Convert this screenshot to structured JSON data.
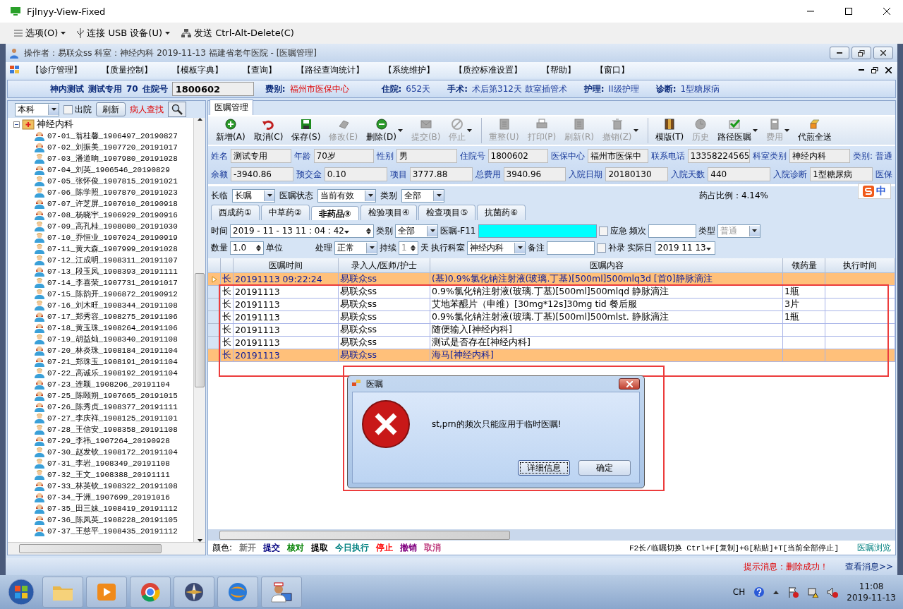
{
  "window": {
    "title": "Fjlnyy-View-Fixed"
  },
  "remote_toolbar": [
    {
      "kind": "menu",
      "label": "选项(O)"
    },
    {
      "kind": "usb",
      "label": "连接 USB 设备(U)"
    },
    {
      "kind": "send",
      "label": "发送 Ctrl-Alt-Delete(C)"
    }
  ],
  "app_title": "操作者：易联众ss  科室：神经内科  2019-11-13  福建省老年医院 - [医嘱管理]",
  "menu": [
    "【诊疗管理】",
    "【质量控制】",
    "【模板字典】",
    "【查询】",
    "【路径查询统计】",
    "【系统维护】",
    "【质控标准设置】",
    "【帮助】",
    "【窗口】"
  ],
  "patient_bar": [
    {
      "kind": "strong",
      "text": "神内测试"
    },
    {
      "kind": "strong",
      "text": "测试专用"
    },
    {
      "kind": "strong",
      "text": "70"
    },
    {
      "kind": "strong",
      "text": "住院号"
    },
    {
      "kind": "field",
      "text": "1800602"
    },
    {
      "kind": "strong",
      "text": "费别:"
    },
    {
      "kind": "alert",
      "text": "福州市医保中心"
    },
    {
      "kind": "strong",
      "text": "住院:"
    },
    {
      "kind": "value",
      "text": "652天"
    },
    {
      "kind": "strong",
      "text": "手术:"
    },
    {
      "kind": "value",
      "text": "术后第312天 鼓室插管术"
    },
    {
      "kind": "strong",
      "text": "护理:"
    },
    {
      "kind": "value",
      "text": "II级护理"
    },
    {
      "kind": "strong",
      "text": "诊断:"
    },
    {
      "kind": "value",
      "text": "1型糖尿病"
    }
  ],
  "left_panel": {
    "scope": "本科",
    "discharged": {
      "label": "出院",
      "checked": false
    },
    "refresh": "刷新",
    "find": "病人查找",
    "tree": {
      "label": "神经内科",
      "expanded": true,
      "children": [
        {
          "label": "07-01_翁桂馨_1906497_20190827",
          "kind": "female",
          "flagged": false
        },
        {
          "label": "07-02_刘振美_1907720_20191017",
          "kind": "female",
          "flagged": false
        },
        {
          "label": "07-03_潘道晌_1907980_20191028",
          "kind": "male",
          "flagged": false
        },
        {
          "label": "07-04_刘英_1906546_20190829",
          "kind": "female",
          "flagged": false
        },
        {
          "label": "07-05_张怀俊_1907815_20191021",
          "kind": "male",
          "flagged": false
        },
        {
          "label": "07-06_陈学照_1907870_20191023",
          "kind": "male",
          "flagged": false
        },
        {
          "label": "07-07_许芝屏_1907010_20190918",
          "kind": "female",
          "flagged": false
        },
        {
          "label": "07-08_杨晓宇_1906929_20190916",
          "kind": "female",
          "flagged": false
        },
        {
          "label": "07-09_高孔桂_1908080_20191030",
          "kind": "male",
          "flagged": false
        },
        {
          "label": "07-10_乔恒业_1907024_20190919",
          "kind": "male",
          "flagged": false
        },
        {
          "label": "07-11_黄大森_1907999_20191028",
          "kind": "male",
          "flagged": false
        },
        {
          "label": "07-12_江成明_1908311_20191107",
          "kind": "male",
          "flagged": false
        },
        {
          "label": "07-13_段玉凤_1908393_20191111",
          "kind": "female",
          "flagged": false
        },
        {
          "label": "07-14_李喜荣_1907731_20191017",
          "kind": "male",
          "flagged": false
        },
        {
          "label": "07-15_陈韵开_1906872_20190912",
          "kind": "male",
          "flagged": false
        },
        {
          "label": "07-16_刘木旺_1908344_20191108",
          "kind": "male",
          "flagged": false
        },
        {
          "label": "07-17_郑秀容_1908275_20191106",
          "kind": "female",
          "flagged": false
        },
        {
          "label": "07-18_黄玉珠_1908264_20191106",
          "kind": "female",
          "flagged": false
        },
        {
          "label": "07-19_胡益灿_1908340_20191108",
          "kind": "male",
          "flagged": false
        },
        {
          "label": "07-20_林炎珠_1908184_20191104",
          "kind": "female",
          "flagged": false
        },
        {
          "label": "07-21_郑珠玉_1908191_20191104",
          "kind": "female",
          "flagged": false
        },
        {
          "label": "07-22_高诚乐_1908192_20191104",
          "kind": "male",
          "flagged": false
        },
        {
          "label": "07-23_连颖_1908206_20191104",
          "kind": "female",
          "flagged": false
        },
        {
          "label": "07-25_陈颐朔_1907665_20191015",
          "kind": "female",
          "flagged": false
        },
        {
          "label": "07-26_陈秀贞_1908377_20191111",
          "kind": "female",
          "flagged": false
        },
        {
          "label": "07-27_李庆祥_1908125_20191101",
          "kind": "male",
          "flagged": false
        },
        {
          "label": "07-28_王信安_1908358_20191108",
          "kind": "male",
          "flagged": false
        },
        {
          "label": "07-29_李祎_1907264_20190928",
          "kind": "female",
          "flagged": false
        },
        {
          "label": "07-30_赵发钦_1908172_20191104",
          "kind": "male",
          "flagged": false
        },
        {
          "label": "07-31_李岩_1908349_20191108",
          "kind": "male",
          "flagged": false
        },
        {
          "label": "07-32_王文_1908388_20191111",
          "kind": "male",
          "flagged": false
        },
        {
          "label": "07-33_林英钦_1908322_20191108",
          "kind": "female",
          "flagged": false
        },
        {
          "label": "07-34_于洲_1907699_20191016",
          "kind": "female",
          "flagged": false
        },
        {
          "label": "07-35_田三妹_1908419_20191112",
          "kind": "female",
          "flagged": false
        },
        {
          "label": "07-36_陈凤英_1908228_20191105",
          "kind": "female",
          "flagged": false
        },
        {
          "label": "07-37_王慈平_1908435_20191112",
          "kind": "female",
          "flagged": false
        }
      ]
    }
  },
  "page_tab": "医嘱管理",
  "toolbar": [
    {
      "kind": "plus",
      "label": "新增(A)",
      "disabled": false,
      "dropdown": false
    },
    {
      "kind": "undo",
      "label": "取消(C)",
      "disabled": false,
      "dropdown": false
    },
    {
      "kind": "save",
      "label": "保存(S)",
      "disabled": false,
      "dropdown": false
    },
    {
      "kind": "eraser",
      "label": "修改(E)",
      "disabled": true,
      "dropdown": false
    },
    {
      "kind": "minus",
      "label": "删除(D)",
      "disabled": false,
      "dropdown": true
    },
    {
      "kind": "mail",
      "label": "提交(B)",
      "disabled": true,
      "dropdown": false
    },
    {
      "kind": "stop",
      "label": "停止",
      "disabled": true,
      "dropdown": true
    },
    {
      "kind": "doc",
      "label": "重整(U)",
      "disabled": true,
      "dropdown": false,
      "separator": true
    },
    {
      "kind": "print",
      "label": "打印(P)",
      "disabled": true,
      "dropdown": false
    },
    {
      "kind": "doc",
      "label": "刷新(R)",
      "disabled": true,
      "dropdown": false
    },
    {
      "kind": "trash",
      "label": "撤销(Z)",
      "disabled": true,
      "dropdown": true
    },
    {
      "kind": "book",
      "label": "模版(T)",
      "disabled": false,
      "dropdown": false,
      "separator": true
    },
    {
      "kind": "clock",
      "label": "历史",
      "disabled": true,
      "dropdown": false
    },
    {
      "kind": "check",
      "label": "路径医嘱",
      "disabled": false,
      "dropdown": true
    },
    {
      "kind": "calc",
      "label": "费用",
      "disabled": true,
      "dropdown": true
    },
    {
      "kind": "pot",
      "label": "代煎全送",
      "disabled": false,
      "dropdown": false
    }
  ],
  "info": [
    [
      {
        "label": "姓名",
        "value": "测试专用"
      },
      {
        "label": "年龄",
        "value": "70岁"
      },
      {
        "label": "性别",
        "value": "男"
      },
      {
        "label": "住院号",
        "value": "1800602"
      },
      {
        "label": "医保中心",
        "value": "福州市医保中"
      },
      {
        "label": "联系电话",
        "value": "13358224565"
      },
      {
        "label": "科室类别",
        "value": "神经内科"
      },
      {
        "label": "类别:",
        "value": "普通",
        "kind": "plain"
      }
    ],
    [
      {
        "label": "余额",
        "value": "-3940.86"
      },
      {
        "label": "预交金",
        "value": "0.10"
      },
      {
        "label": "项目",
        "value": "3777.88"
      },
      {
        "label": "总费用",
        "value": "3940.96"
      },
      {
        "label": "入院日期",
        "value": "20180130"
      },
      {
        "label": "入院天数",
        "value": "440"
      },
      {
        "label": "入院诊断",
        "value": "1型糖尿病"
      },
      {
        "label": "医保",
        "kind": "label"
      }
    ]
  ],
  "filter": [
    {
      "kind": "label",
      "text": "长临"
    },
    {
      "kind": "select",
      "text": "长嘱"
    },
    {
      "kind": "label",
      "text": "医嘱状态"
    },
    {
      "kind": "select",
      "text": "当前有效"
    },
    {
      "kind": "label",
      "text": "类别"
    },
    {
      "kind": "select",
      "text": "全部"
    }
  ],
  "drug_ratio": "药占比例：4.14%",
  "ime": "中",
  "subtabs": [
    {
      "label": "西成药①",
      "selected": false
    },
    {
      "label": "中草药②",
      "selected": false
    },
    {
      "label": "非药品③",
      "selected": true
    },
    {
      "label": "检验项目④",
      "selected": false
    },
    {
      "label": "检查项目⑤",
      "selected": false
    },
    {
      "label": "抗菌药⑥",
      "selected": false
    }
  ],
  "form": [
    [
      {
        "kind": "label",
        "text": "时间"
      },
      {
        "kind": "datetime",
        "text": "2019 - 11 - 13    11 : 04 : 42"
      },
      {
        "kind": "label",
        "text": "类别"
      },
      {
        "kind": "select",
        "text": "全部"
      },
      {
        "kind": "label",
        "text": "医嘱-F11"
      },
      {
        "kind": "search"
      },
      {
        "kind": "checkbox",
        "text": "应急",
        "checked": false
      },
      {
        "kind": "label",
        "text": "频次"
      },
      {
        "kind": "input"
      },
      {
        "kind": "label",
        "text": "类型"
      },
      {
        "kind": "select",
        "text": "普通",
        "disabled": true
      }
    ],
    [
      {
        "kind": "label",
        "text": "数量"
      },
      {
        "kind": "spin",
        "text": "1.0"
      },
      {
        "kind": "label",
        "text": "单位"
      },
      {
        "kind": "gap"
      },
      {
        "kind": "label",
        "text": "处理"
      },
      {
        "kind": "select",
        "text": "正常"
      },
      {
        "kind": "label",
        "text": "持续"
      },
      {
        "kind": "spin",
        "text": "1",
        "disabled": true
      },
      {
        "kind": "label",
        "text": "天"
      },
      {
        "kind": "label",
        "text": "执行科室"
      },
      {
        "kind": "select",
        "text": "神经内科"
      },
      {
        "kind": "label",
        "text": "备注"
      },
      {
        "kind": "input"
      },
      {
        "kind": "checkbox",
        "text": "补录",
        "checked": false
      },
      {
        "kind": "label",
        "text": "实际日"
      },
      {
        "kind": "date",
        "text": "2019 11 13"
      }
    ]
  ],
  "table": {
    "columns": [
      "医嘱时间",
      "录入人/医师/护士",
      "医嘱内容",
      "领药量",
      "执行时间"
    ],
    "rows": [
      {
        "type": "长",
        "time": "20191113 09:22:24",
        "author": "易联众ss",
        "content": "(基)0.9%氯化钠注射液(玻璃.丁基)[500ml]500mlq3d [首0]静脉滴注",
        "selected": true,
        "cursor": true
      },
      {
        "type": "长",
        "time": "20191113",
        "author": "易联众ss",
        "content": "0.9%氯化钠注射液(玻璃.丁基)[500ml]500mlqd 静脉滴注",
        "qty": "1瓶",
        "selected": false,
        "cursor": false
      },
      {
        "type": "长",
        "time": "20191113",
        "author": "易联众ss",
        "content": "艾地苯醌片（申维）[30mg*12s]30mg tid 餐后服",
        "qty": "3片",
        "selected": false,
        "cursor": false
      },
      {
        "type": "长",
        "time": "20191113",
        "author": "易联众ss",
        "content": "0.9%氯化钠注射液(玻璃.丁基)[500ml]500mlst. 静脉滴注",
        "qty": "1瓶",
        "selected": false,
        "cursor": false
      },
      {
        "type": "长",
        "time": "20191113",
        "author": "易联众ss",
        "content": "随便输入[神经内科]",
        "selected": false,
        "cursor": false
      },
      {
        "type": "长",
        "time": "20191113",
        "author": "易联众ss",
        "content": "测试是否存在[神经内科]",
        "selected": false,
        "cursor": false
      },
      {
        "type": "长",
        "time": "20191113",
        "author": "易联众ss",
        "content": "海马[神经内科]",
        "selected": true,
        "cursor": false
      }
    ]
  },
  "legend": {
    "label": "颜色:",
    "items": [
      {
        "label": "新开",
        "color": "#808080"
      },
      {
        "label": "提交",
        "color": "#000080"
      },
      {
        "label": "核对",
        "color": "#008000"
      },
      {
        "label": "提取",
        "color": "#000000"
      },
      {
        "label": "今日执行",
        "color": "#008080"
      },
      {
        "label": "停止",
        "color": "#ff0000"
      },
      {
        "label": "撤销",
        "color": "#800080"
      },
      {
        "label": "取消",
        "color": "#c04080"
      }
    ]
  },
  "hotkeys": "F2长/临嘱切换 Ctrl+F[复制]+G[粘贴]+T[当前全部停止]",
  "browse": "医嘱浏览",
  "dialog": {
    "title": "医嘱",
    "message": "st,prn的频次只能应用于临时医嘱!",
    "buttons": [
      {
        "label": "详细信息",
        "selected": true
      },
      {
        "label": "确定",
        "selected": false
      }
    ]
  },
  "status": {
    "message": "提示消息：删除成功！",
    "link": "查看消息>>"
  },
  "taskbar": {
    "apps": [
      {
        "kind": "folder"
      },
      {
        "kind": "media"
      },
      {
        "kind": "browser"
      },
      {
        "kind": "compass"
      },
      {
        "kind": "swirl"
      },
      {
        "kind": "doctor"
      }
    ],
    "lang": "CH",
    "time": "11:08",
    "date": "2019-11-13"
  }
}
